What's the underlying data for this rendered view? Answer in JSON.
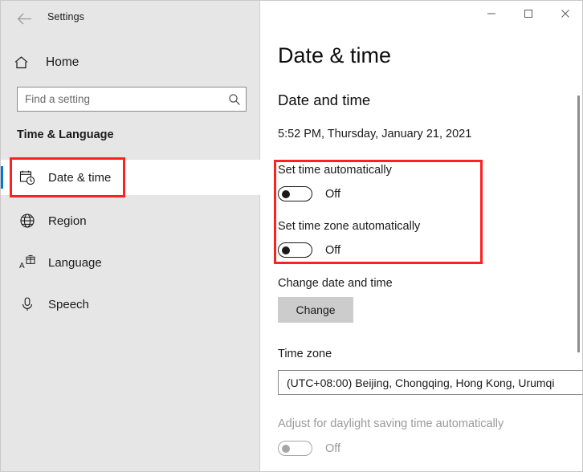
{
  "window": {
    "app_title": "Settings",
    "back_icon": "back-arrow-icon",
    "controls": {
      "minimize_label": "—",
      "maximize_label": "□",
      "close_label": "✕"
    }
  },
  "sidebar": {
    "home": {
      "label": "Home",
      "icon": "home-icon"
    },
    "search": {
      "value": "",
      "placeholder": "Find a setting",
      "icon": "search-icon"
    },
    "group_title": "Time & Language",
    "items": [
      {
        "label": "Date & time",
        "icon": "calendar-clock-icon",
        "selected": true
      },
      {
        "label": "Region",
        "icon": "globe-icon",
        "selected": false
      },
      {
        "label": "Language",
        "icon": "language-icon",
        "selected": false
      },
      {
        "label": "Speech",
        "icon": "microphone-icon",
        "selected": false
      }
    ]
  },
  "main": {
    "page_title": "Date & time",
    "section_title": "Date and time",
    "current_datetime": "5:52 PM, Thursday, January 21, 2021",
    "set_time_auto": {
      "label": "Set time automatically",
      "state": "Off"
    },
    "set_timezone_auto": {
      "label": "Set time zone automatically",
      "state": "Off"
    },
    "change_datetime": {
      "label": "Change date and time",
      "button_label": "Change"
    },
    "timezone": {
      "label": "Time zone",
      "value": "(UTC+08:00) Beijing, Chongqing, Hong Kong, Urumqi"
    },
    "daylight_saving": {
      "label": "Adjust for daylight saving time automatically",
      "state": "Off"
    }
  },
  "annotations": {
    "color": "#ff2020",
    "boxes": [
      "date-time-nav-item",
      "auto-time-toggles"
    ]
  },
  "colors": {
    "accent": "#0078d7",
    "sidebar_bg": "#e6e6e6",
    "highlight": "#ff2020"
  }
}
